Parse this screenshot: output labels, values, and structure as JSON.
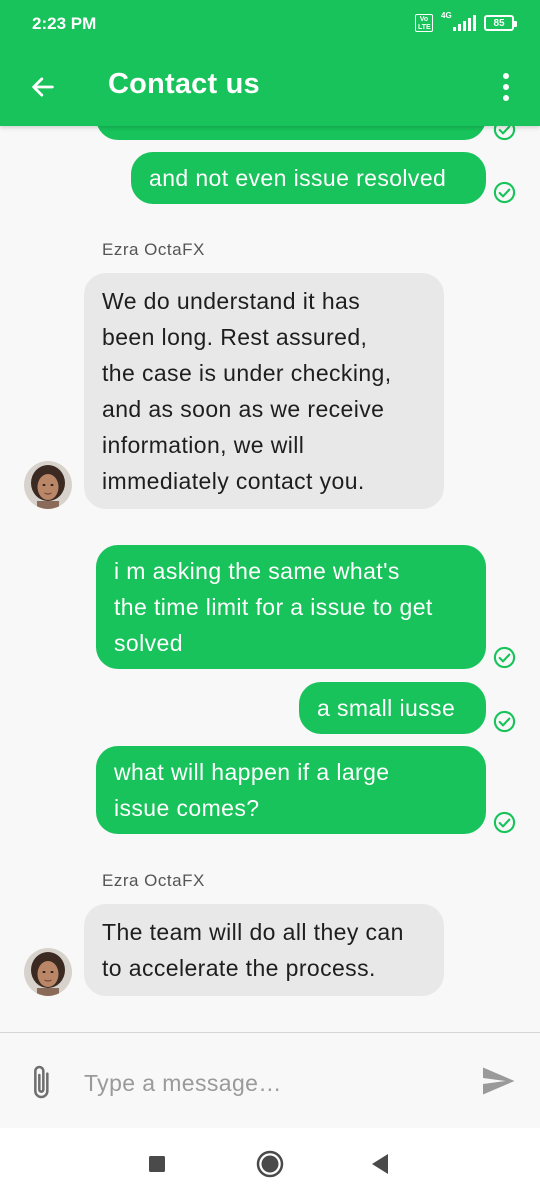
{
  "status_bar": {
    "time": "2:23 PM",
    "volte": "Vo LTE",
    "network": "4G",
    "battery": "85"
  },
  "app_bar": {
    "title": "Contact us",
    "back_icon": "arrow-left-icon",
    "more_icon": "more-vertical-icon"
  },
  "messages": [
    {
      "from": "me",
      "text": "and not even issue resolved",
      "status": "delivered"
    },
    {
      "from": "agent",
      "sender": "Ezra OctaFX",
      "lines": [
        "We do understand it has",
        "been long. Rest assured,",
        "the case is under checking,",
        "and as soon as we receive",
        "information, we will",
        "immediately contact you."
      ]
    },
    {
      "from": "me",
      "lines": [
        "i m asking the same what's",
        "the time limit for a issue to get",
        "solved"
      ],
      "status": "delivered"
    },
    {
      "from": "me",
      "text": "a small iusse",
      "status": "delivered"
    },
    {
      "from": "me",
      "lines": [
        "what will happen if a large",
        "issue comes?"
      ],
      "status": "delivered"
    },
    {
      "from": "agent",
      "sender": "Ezra OctaFX",
      "lines": [
        "The team will do all they can",
        "to accelerate the process."
      ]
    }
  ],
  "composer": {
    "placeholder": "Type a message…",
    "attach_icon": "paperclip-icon",
    "send_icon": "send-icon"
  },
  "nav": {
    "recents_icon": "square-icon",
    "home_icon": "circle-icon",
    "back_icon": "triangle-back-icon"
  },
  "colors": {
    "brand": "#17c35a",
    "incoming_bubble": "#e8e8e8",
    "background": "#f8f8f8"
  }
}
